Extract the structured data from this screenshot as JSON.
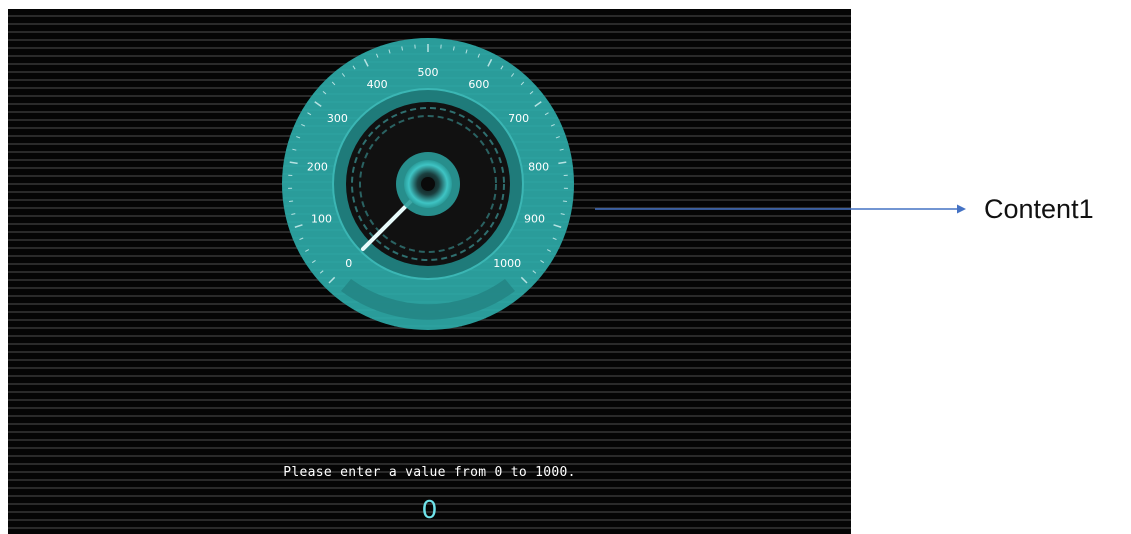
{
  "gauge": {
    "min": 0,
    "max": 1000,
    "value": 0,
    "tick_labels": [
      "0",
      "100",
      "200",
      "300",
      "400",
      "500",
      "600",
      "700",
      "800",
      "900",
      "1000"
    ]
  },
  "instruction_text": "Please enter a value from 0 to 1000.",
  "value_display": "0",
  "annotation": {
    "label": "Content1"
  },
  "colors": {
    "gauge_face": "#2a9c9a",
    "gauge_inner_ring": "#1e7675",
    "gauge_dial": "#111111",
    "needle": "#e8fbfb",
    "value_text": "#6fe3ea",
    "arrow": "#4472c4",
    "stripe_dark": "#050505",
    "stripe_light": "#2a2a2a"
  }
}
